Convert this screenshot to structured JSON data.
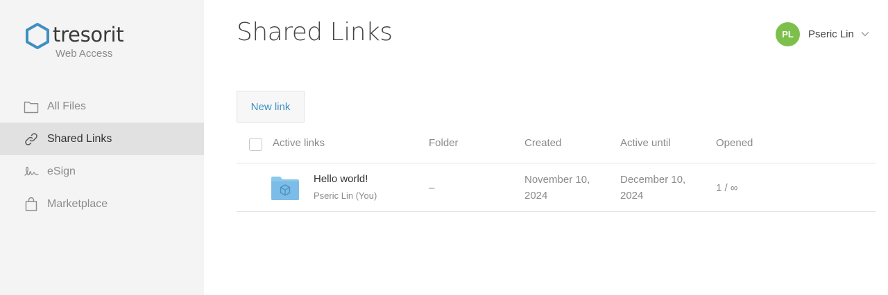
{
  "brand": {
    "name": "tresorit",
    "subtitle": "Web Access",
    "accent": "#3d8fc2"
  },
  "sidebar": {
    "items": [
      {
        "label": "All Files",
        "icon": "folder-icon",
        "active": false
      },
      {
        "label": "Shared Links",
        "icon": "link-icon",
        "active": true
      },
      {
        "label": "eSign",
        "icon": "signature-icon",
        "active": false
      },
      {
        "label": "Marketplace",
        "icon": "shopping-bag-icon",
        "active": false
      }
    ]
  },
  "header": {
    "title": "Shared Links",
    "user": {
      "initials": "PL",
      "name": "Pseric Lin",
      "avatar_color": "#7cc04b"
    }
  },
  "toolbar": {
    "new_link_label": "New link"
  },
  "table": {
    "columns": [
      "Active links",
      "Folder",
      "Created",
      "Active until",
      "Opened"
    ],
    "rows": [
      {
        "name": "Hello world!",
        "owner": "Pseric Lin (You)",
        "folder": "–",
        "created_line1": "November 10,",
        "created_line2": "2024",
        "until_line1": "December 10,",
        "until_line2": "2024",
        "opened": "1 / ∞"
      }
    ]
  }
}
